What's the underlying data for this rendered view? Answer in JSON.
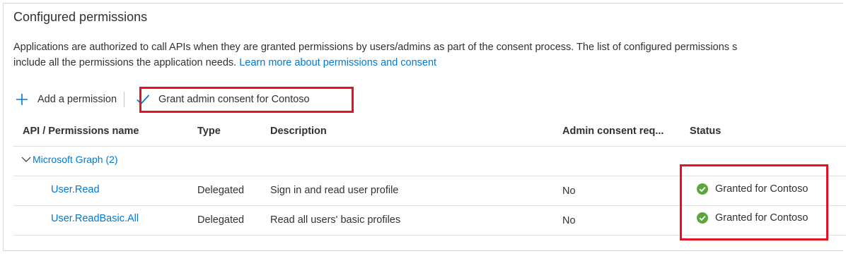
{
  "section": {
    "title": "Configured permissions",
    "description_line1": "Applications are authorized to call APIs when they are granted permissions by users/admins as part of the consent process. The list of configured permissions s",
    "description_line2": "include all the permissions the application needs. ",
    "learn_more_link": "Learn more about permissions and consent"
  },
  "toolbar": {
    "add_icon": "plus-icon",
    "add_label": "Add a permission",
    "grant_icon": "checkmark-icon",
    "grant_label": "Grant admin consent for Contoso"
  },
  "table": {
    "columns": [
      "API / Permissions name",
      "Type",
      "Description",
      "Admin consent req...",
      "Status"
    ],
    "group": {
      "icon": "chevron-down-icon",
      "label": "Microsoft Graph (2)"
    },
    "rows": [
      {
        "name": "User.Read",
        "type": "Delegated",
        "description": "Sign in and read user profile",
        "admin_consent": "No",
        "status_icon": "success-check-icon",
        "status": "Granted for Contoso"
      },
      {
        "name": "User.ReadBasic.All",
        "type": "Delegated",
        "description": "Read all users' basic profiles",
        "admin_consent": "No",
        "status_icon": "success-check-icon",
        "status": "Granted for Contoso"
      }
    ]
  },
  "colors": {
    "link": "#0078d4",
    "highlight": "#e81123",
    "success": "#107c10",
    "text": "#323130"
  }
}
